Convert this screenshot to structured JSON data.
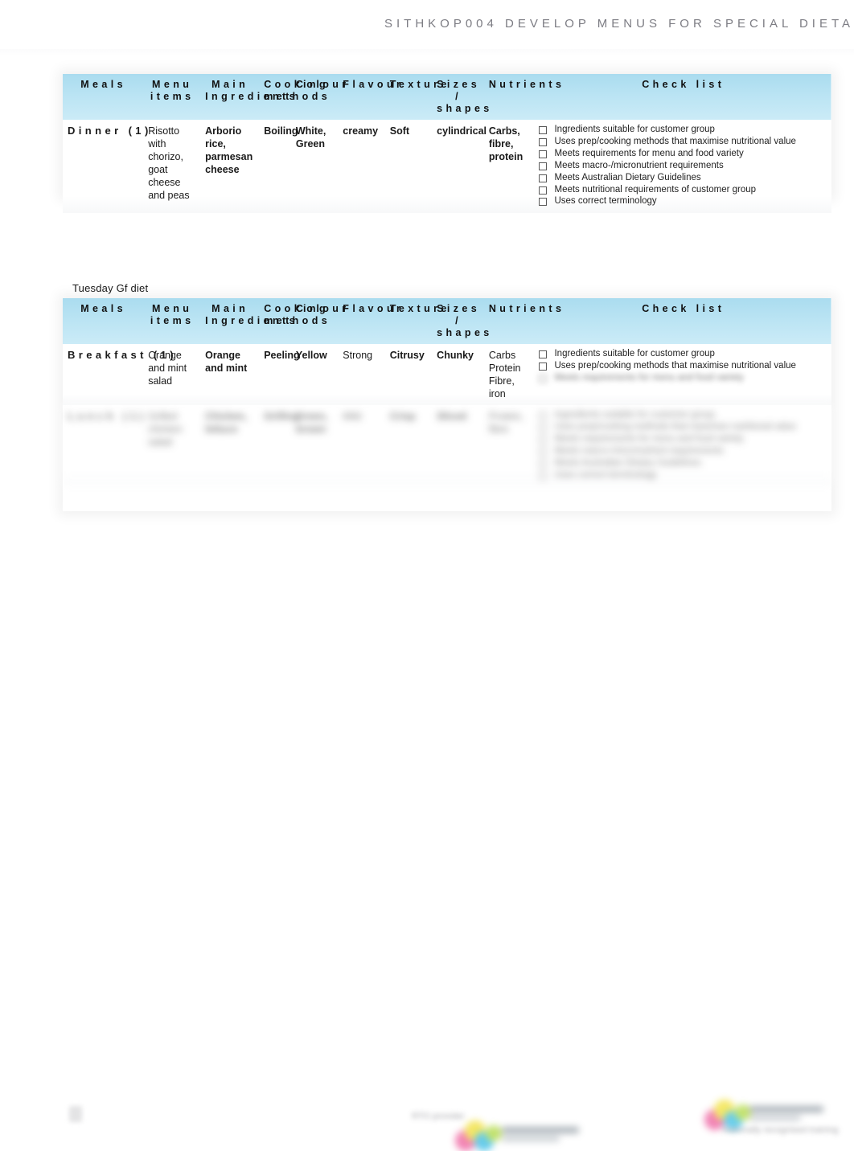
{
  "header": {
    "title": "SITHKOP004 DEVELOP MENUS FOR SPECIAL DIETA"
  },
  "columns": [
    "Meals",
    "Menu items",
    "Main Ingredients",
    "Cooking methods",
    "Colour",
    "Flavour",
    "Texture",
    "Sizes / shapes",
    "Nutrients",
    "Check list"
  ],
  "table1": {
    "rows": [
      {
        "meal": "Dinner (1)",
        "menu_item": "Risotto with chorizo, goat cheese and peas",
        "ingredients": "Arborio rice, parmesan cheese",
        "cooking_method": "Boiling",
        "colour": "White, Green",
        "flavour": "creamy",
        "texture": "Soft",
        "size_shape": "cylindrical",
        "nutrients": "Carbs, fibre, protein",
        "checklist": [
          "Ingredients suitable for customer group",
          "Uses prep/cooking methods that maximise nutritional value",
          "Meets requirements for menu and food variety",
          "Meets macro-/micronutrient requirements",
          "Meets Australian Dietary Guidelines",
          "Meets nutritional requirements of customer group",
          "Uses correct terminology"
        ]
      }
    ]
  },
  "section2": {
    "label": "Tuesday Gf diet"
  },
  "table2": {
    "rows": [
      {
        "meal": "Breakfast (1)",
        "menu_item": "Orange and mint salad",
        "ingredients": "Orange and mint",
        "cooking_method": "Peeling",
        "colour": "Yellow",
        "flavour": "Strong",
        "texture": "Citrusy",
        "size_shape": "Chunky",
        "nutrients": "Carbs Protein Fibre, iron",
        "checklist": [
          "Ingredients suitable for customer group",
          "Uses prep/cooking methods that maximise nutritional value",
          "Meets requirements for menu and food variety"
        ]
      },
      {
        "meal": "Lunch (1)",
        "menu_item": "Grilled chicken salad",
        "ingredients": "Chicken, lettuce",
        "cooking_method": "Grilling",
        "colour": "Green, brown",
        "flavour": "Mild",
        "texture": "Crisp",
        "size_shape": "Sliced",
        "nutrients": "Protein, fibre",
        "checklist": [
          "Ingredients suitable for customer group",
          "Uses prep/cooking methods that maximise nutritional value",
          "Meets requirements for menu and food variety",
          "Meets macro-/micronutrient requirements",
          "Meets Australian Dietary Guidelines",
          "Uses correct terminology"
        ]
      }
    ]
  },
  "footer": {
    "left_mark": "page-mark",
    "center_logo": "organisation-logo",
    "right_logo": "accreditation-logo",
    "center_caption": "RTO provider",
    "right_caption": "Nationally recognised training"
  }
}
